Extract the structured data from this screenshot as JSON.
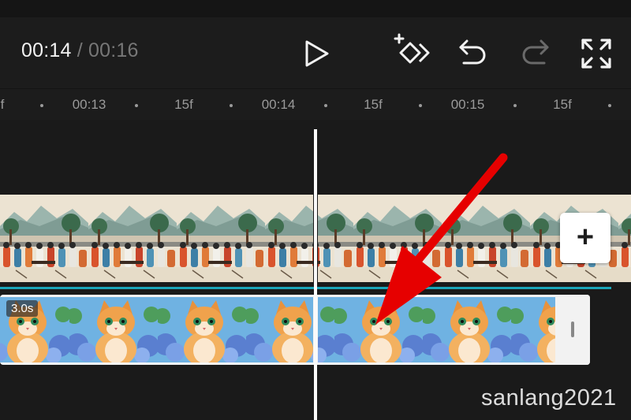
{
  "header": {
    "current_time": "00:14",
    "separator": "/",
    "total_time": "00:16"
  },
  "toolbar": {
    "icons": [
      "play-icon",
      "add-keyframe-icon",
      "undo-icon",
      "redo-icon",
      "fullscreen-icon"
    ],
    "redo_enabled": false
  },
  "ruler": {
    "labels": [
      "f",
      "00:13",
      "15f",
      "00:14",
      "15f",
      "00:15",
      "15f"
    ]
  },
  "clips": {
    "video_duration": "3.0s",
    "add_label": "+"
  },
  "watermark": "sanlang2021",
  "colors": {
    "background": "#1a1a1a",
    "accent_line": "#19a5b8",
    "arrow": "#e60000"
  }
}
